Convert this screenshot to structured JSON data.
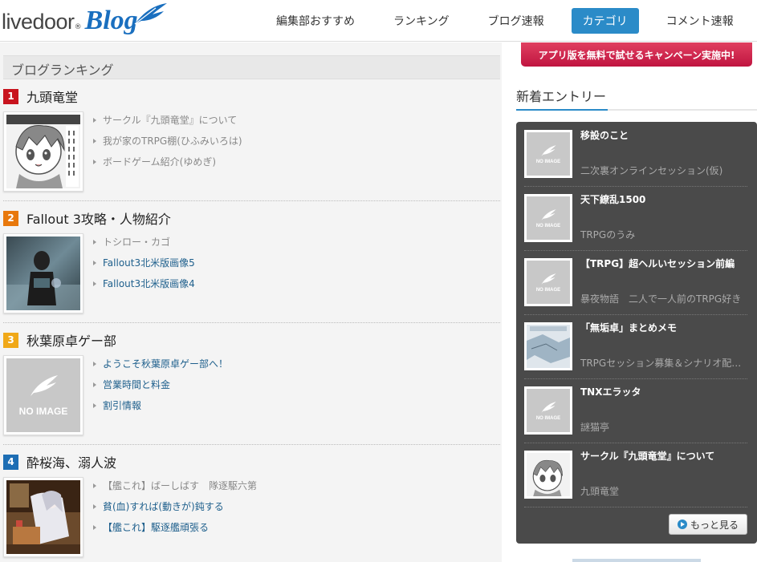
{
  "header": {
    "logo_text": "livedoor",
    "logo_reg": "®",
    "logo_blog": "Blog",
    "nav": [
      {
        "label": "編集部おすすめ",
        "active": false
      },
      {
        "label": "ランキング",
        "active": false
      },
      {
        "label": "ブログ速報",
        "active": false
      },
      {
        "label": "カテゴリ",
        "active": true
      },
      {
        "label": "コメント速報",
        "active": false
      }
    ]
  },
  "ranking": {
    "title": "ブログランキング",
    "items": [
      {
        "rank": "1",
        "rank_color": "#c8141e",
        "blog": "九頭竜堂",
        "links": [
          {
            "text": "サークル『九頭竜堂』について",
            "style": "gray"
          },
          {
            "text": "我が家のTRPG棚(ひふみいろは)",
            "style": "gray"
          },
          {
            "text": "ボードゲーム紹介(ゆめぎ)",
            "style": "gray"
          }
        ]
      },
      {
        "rank": "2",
        "rank_color": "#e8780c",
        "blog": "Fallout 3攻略・人物紹介",
        "links": [
          {
            "text": "トシロー・カゴ",
            "style": "gray"
          },
          {
            "text": "Fallout3北米版画像5",
            "style": "blue"
          },
          {
            "text": "Fallout3北米版画像4",
            "style": "blue"
          }
        ]
      },
      {
        "rank": "3",
        "rank_color": "#f0a818",
        "blog": "秋葉原卓ゲー部",
        "no_image": "NO IMAGE",
        "links": [
          {
            "text": "ようこそ秋葉原卓ゲー部へ！",
            "style": "blue"
          },
          {
            "text": "営業時間と料金",
            "style": "blue"
          },
          {
            "text": "割引情報",
            "style": "blue"
          }
        ]
      },
      {
        "rank": "4",
        "rank_color": "#1e6eb4",
        "blog": "酔桜海、溺人波",
        "links": [
          {
            "text": "【艦これ】ばーしばす　隊逐駆六第",
            "style": "gray"
          },
          {
            "text": "貧(血)すれば(動きが)鈍する",
            "style": "blue"
          },
          {
            "text": "【艦これ】駆逐艦頑張る",
            "style": "blue"
          }
        ]
      }
    ]
  },
  "sidebar": {
    "banner": "アプリ版を無料で試せるキャンペーン実施中!",
    "new_entries_title": "新着エントリー",
    "no_image": "NO IMAGE",
    "entries": [
      {
        "title": "移設のこと",
        "source": "二次裏オンラインセッション(仮)",
        "thumb": "noimage"
      },
      {
        "title": "天下繚乱1500",
        "source": "TRPGのうみ",
        "thumb": "noimage"
      },
      {
        "title": "【TRPG】超ヘルいセッション前編",
        "source": "暴夜物語　二人で一人前のTRPG好き",
        "thumb": "noimage"
      },
      {
        "title": "「無垢卓」まとめメモ",
        "source": "TRPGセッション募集＆シナリオ配布ページ",
        "thumb": "map"
      },
      {
        "title": "TNXエラッタ",
        "source": "謎猫亭",
        "thumb": "noimage"
      },
      {
        "title": "サークル『九頭竜堂』について",
        "source": "九頭竜堂",
        "thumb": "anime"
      }
    ],
    "more_label": "もっと見る"
  },
  "colors": {
    "accent": "#2b8bc8",
    "sidebar_bg": "#4a4a4a",
    "banner": "#d01e46"
  }
}
